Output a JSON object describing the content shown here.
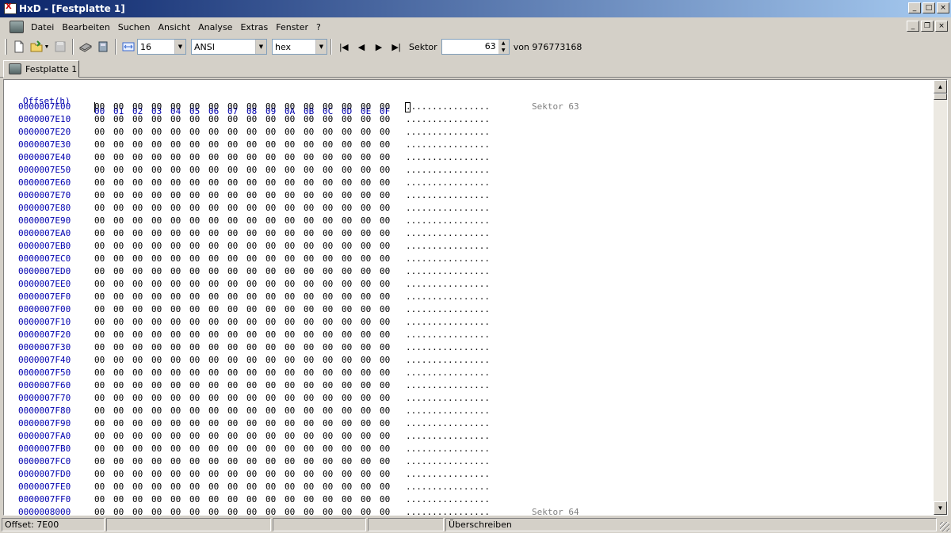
{
  "window": {
    "title": "HxD - [Festplatte 1]"
  },
  "menu": {
    "items": [
      "Datei",
      "Bearbeiten",
      "Suchen",
      "Ansicht",
      "Analyse",
      "Extras",
      "Fenster",
      "?"
    ]
  },
  "toolbar": {
    "bytes_per_row": "16",
    "charset": "ANSI",
    "offset_base": "hex",
    "sector_label": "Sektor",
    "sector_value": "63",
    "sector_total": "von 976773168"
  },
  "tabs": [
    "Festplatte 1"
  ],
  "hex": {
    "offset_header": "Offset(h)",
    "columns": [
      "00",
      "01",
      "02",
      "03",
      "04",
      "05",
      "06",
      "07",
      "08",
      "09",
      "0A",
      "0B",
      "0C",
      "0D",
      "0E",
      "0F"
    ],
    "rows": [
      "0000007E00",
      "0000007E10",
      "0000007E20",
      "0000007E30",
      "0000007E40",
      "0000007E50",
      "0000007E60",
      "0000007E70",
      "0000007E80",
      "0000007E90",
      "0000007EA0",
      "0000007EB0",
      "0000007EC0",
      "0000007ED0",
      "0000007EE0",
      "0000007EF0",
      "0000007F00",
      "0000007F10",
      "0000007F20",
      "0000007F30",
      "0000007F40",
      "0000007F50",
      "0000007F60",
      "0000007F70",
      "0000007F80",
      "0000007F90",
      "0000007FA0",
      "0000007FB0",
      "0000007FC0",
      "0000007FD0",
      "0000007FE0",
      "0000007FF0",
      "0000008000"
    ],
    "byte_value": "00",
    "ascii_value": "................",
    "sector_labels": [
      "Sektor 63",
      "Sektor 64"
    ]
  },
  "status": {
    "offset": "Offset: 7E00",
    "mode": "Überschreiben"
  },
  "colors": {
    "offset_text": "#0000b0",
    "sector_label": "#808080",
    "titlebar_start": "#0a246a",
    "titlebar_end": "#a6caf0"
  }
}
